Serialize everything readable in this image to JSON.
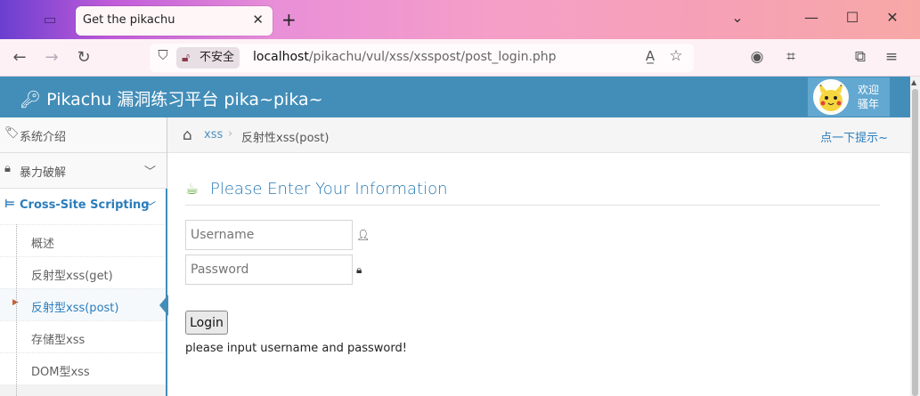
{
  "browser": {
    "tab_title": "Get the pikachu",
    "tab_close": "✕",
    "new_tab": "+",
    "security_label": "不安全",
    "url_host": "localhost",
    "url_path": "/pikachu/vul/xss/xsspost/post_login.php"
  },
  "header": {
    "logo": "Pikachu 漏洞练习平台 pika~pika~",
    "user_line1": "欢迎",
    "user_line2": "骚年"
  },
  "sidebar": {
    "items": [
      {
        "label": "系统介绍"
      },
      {
        "label": "暴力破解"
      },
      {
        "label": "Cross-Site Scripting"
      }
    ],
    "sub_items": [
      {
        "label": "概述"
      },
      {
        "label": "反射型xss(get)"
      },
      {
        "label": "反射型xss(post)"
      },
      {
        "label": "存储型xss"
      },
      {
        "label": "DOM型xss"
      }
    ]
  },
  "breadcrumbs": {
    "link": "xss",
    "separator": "›",
    "current": "反射性xss(post)",
    "hint": "点一下提示~"
  },
  "form": {
    "title": "Please Enter Your Information",
    "username_placeholder": "Username",
    "password_placeholder": "Password",
    "login_label": "Login",
    "message": "please input username and password!"
  },
  "colors": {
    "header_bg": "#438eb9",
    "link": "#2b7dbc",
    "title": "#2679b5",
    "cup_icon": "#69aa46"
  }
}
